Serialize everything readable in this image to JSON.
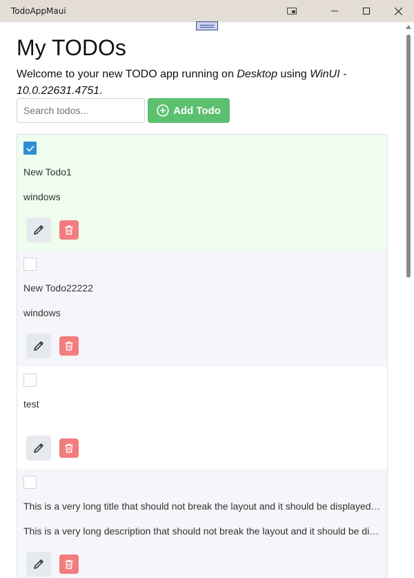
{
  "window": {
    "title": "TodoAppMaui"
  },
  "page": {
    "heading": "My TODOs",
    "welcome_prefix": "Welcome to your new TODO app running on ",
    "platform": "Desktop",
    "welcome_mid": " using ",
    "runtime": "WinUI - 10.0.22631.4751",
    "welcome_suffix": "."
  },
  "search": {
    "placeholder": "Search todos...",
    "value": ""
  },
  "add_button": {
    "label": "Add Todo",
    "color": "#5cc16f"
  },
  "todos": [
    {
      "title": "New Todo1",
      "description": "windows",
      "completed": true
    },
    {
      "title": "New Todo22222",
      "description": "windows",
      "completed": false
    },
    {
      "title": "test",
      "description": "",
      "completed": false
    },
    {
      "title": "This is a very long title that should not break the layout and it should be displayed properly",
      "description": "This is a very long description that should not break the layout and it should be displayed properly",
      "completed": false
    }
  ],
  "colors": {
    "completed_row": "#eefdee",
    "alt_row": "#f5f6f9",
    "checkbox_checked": "#2f8fd6",
    "delete_button": "#f27c7e",
    "edit_button": "#e6e9ed"
  },
  "icons": {
    "edit": "pencil-icon",
    "delete": "trash-icon",
    "add": "plus-circle-icon",
    "check": "checkmark-icon"
  }
}
